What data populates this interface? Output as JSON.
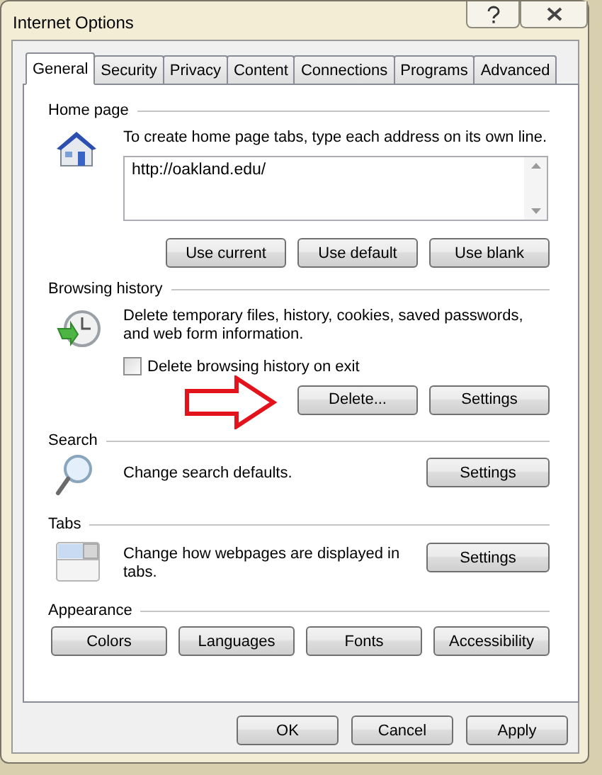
{
  "window": {
    "title": "Internet Options"
  },
  "tabs": [
    {
      "label": "General",
      "selected": true
    },
    {
      "label": "Security",
      "selected": false
    },
    {
      "label": "Privacy",
      "selected": false
    },
    {
      "label": "Content",
      "selected": false
    },
    {
      "label": "Connections",
      "selected": false
    },
    {
      "label": "Programs",
      "selected": false
    },
    {
      "label": "Advanced",
      "selected": false
    }
  ],
  "sections": [
    {
      "kind": "home",
      "heading": "Home page",
      "description": "To create home page tabs, type each address on its own line.",
      "addresses": "http://oakland.edu/",
      "buttons": [
        "Use current",
        "Use default",
        "Use blank"
      ]
    },
    {
      "kind": "history",
      "heading": "Browsing history",
      "description": "Delete temporary files, history, cookies, saved passwords, and web form information.",
      "checkbox": {
        "label": "Delete browsing history on exit",
        "checked": false
      },
      "buttons": [
        "Delete...",
        "Settings"
      ]
    },
    {
      "kind": "search",
      "heading": "Search",
      "description": "Change search defaults.",
      "buttons": [
        "Settings"
      ]
    },
    {
      "kind": "tabs",
      "heading": "Tabs",
      "description": "Change how webpages are displayed in tabs.",
      "buttons": [
        "Settings"
      ]
    },
    {
      "kind": "appearance",
      "heading": "Appearance",
      "buttons": [
        "Colors",
        "Languages",
        "Fonts",
        "Accessibility"
      ]
    }
  ],
  "footer_buttons": [
    "OK",
    "Cancel",
    "Apply"
  ]
}
